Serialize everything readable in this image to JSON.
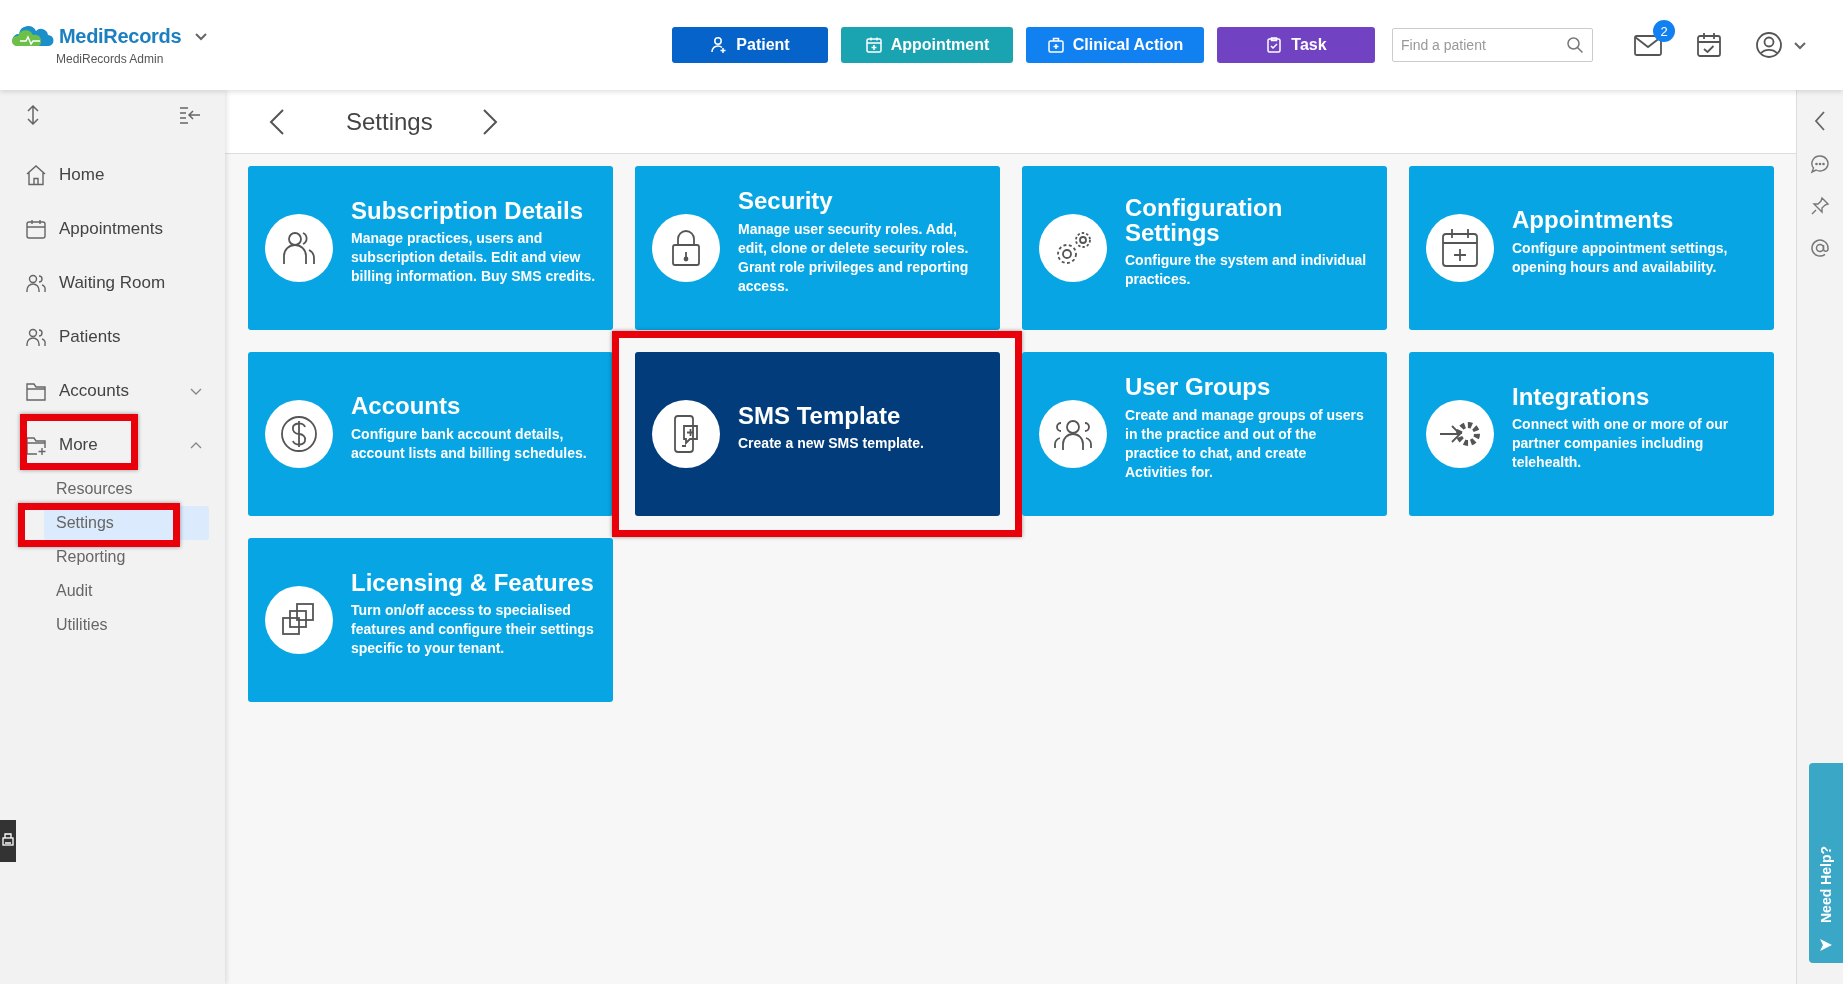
{
  "header": {
    "logo": "MediRecords",
    "account": "MediRecords Admin",
    "actions": [
      {
        "label": "Patient",
        "color": "#0663c9"
      },
      {
        "label": "Appointment",
        "color": "#1aa3b0"
      },
      {
        "label": "Clinical Action",
        "color": "#1181f2"
      },
      {
        "label": "Task",
        "color": "#7142c2"
      }
    ],
    "search": {
      "placeholder": "Find a patient"
    },
    "mail_badge": "2"
  },
  "sidebar": {
    "items": [
      {
        "label": "Home",
        "selected": false
      },
      {
        "label": "Appointments",
        "selected": false
      },
      {
        "label": "Waiting Room",
        "selected": false
      },
      {
        "label": "Patients",
        "selected": false
      },
      {
        "label": "Accounts",
        "selected": false,
        "expanded": false,
        "highlighted": false
      },
      {
        "label": "More",
        "selected": false,
        "expanded": true,
        "highlighted": true,
        "children": [
          {
            "label": "Resources",
            "selected": false,
            "highlighted": false
          },
          {
            "label": "Settings",
            "selected": true,
            "highlighted": true
          },
          {
            "label": "Reporting",
            "selected": false,
            "highlighted": false
          },
          {
            "label": "Audit",
            "selected": false,
            "highlighted": false
          },
          {
            "label": "Utilities",
            "selected": false,
            "highlighted": false
          }
        ]
      }
    ]
  },
  "page": {
    "title": "Settings"
  },
  "cards": [
    {
      "title": "Subscription Details",
      "description": "Manage practices, users and subscription details. Edit and view billing information. Buy SMS credits.",
      "selected": false,
      "highlighted": false
    },
    {
      "title": "Security",
      "description": "Manage user security roles. Add, edit, clone or delete security roles. Grant role privileges and reporting access.",
      "selected": false,
      "highlighted": false
    },
    {
      "title": "Configuration Settings",
      "description": "Configure the system and individual practices.",
      "selected": false,
      "highlighted": false
    },
    {
      "title": "Appointments",
      "description": "Configure appointment settings, opening hours and availability.",
      "selected": false,
      "highlighted": false
    },
    {
      "title": "Accounts",
      "description": "Configure bank account details, account lists and billing schedules.",
      "selected": false,
      "highlighted": false
    },
    {
      "title": "SMS Template",
      "description": "Create a new SMS template.",
      "selected": true,
      "highlighted": true
    },
    {
      "title": "User Groups",
      "description": "Create and manage groups of users in the practice and out of the practice to chat, and create Activities for.",
      "selected": false,
      "highlighted": false
    },
    {
      "title": "Integrations",
      "description": "Connect with one or more of our partner companies including telehealth.",
      "selected": false,
      "highlighted": false
    },
    {
      "title": "Licensing & Features",
      "description": "Turn on/off access to specialised features and configure their settings specific to your tenant.",
      "selected": false,
      "highlighted": false
    }
  ],
  "help_tab": {
    "label": "Need Help?"
  }
}
